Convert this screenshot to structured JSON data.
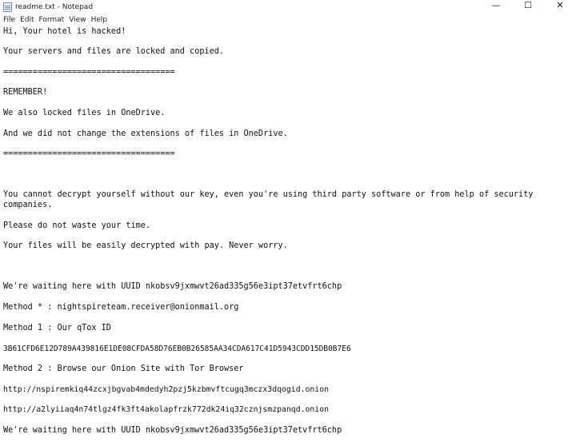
{
  "window": {
    "title": "readme.txt - Notepad",
    "icon": "notepad-icon",
    "controls": {
      "minimize": "—",
      "maximize": "☐",
      "close": "✕"
    }
  },
  "menu": [
    "File",
    "Edit",
    "Format",
    "View",
    "Help"
  ],
  "document": {
    "greeting": "Hi, Your hotel is hacked!",
    "locked": "Your servers and files are locked and copied.",
    "divider1": "===================================",
    "remember": "REMEMBER!",
    "onedrive1": "We also locked files in OneDrive.",
    "onedrive2": "And we did not change the extensions of files in OneDrive.",
    "divider2": "===================================",
    "decrypt_line1": "You cannot decrypt yourself without our key, even you're using third party software or from help of security",
    "decrypt_line2": "companies.",
    "waste": "Please do not waste your time.",
    "pay": "Your files will be easily decrypted with pay. Never worry.",
    "waiting1": "We're waiting here with UUID nkobsv9jxmwvt26ad335g56e3ipt37etvfrt6chp",
    "method_star": "Method * : nightspireteam.receiver@onionmail.org",
    "method1": "Method 1 : Our qTox ID",
    "qtox_id": "3B61CFD6E12D789A439816E1DE08CFDA58D76EB0B26585AA34CDA617C41D5943CDD15DB0B7E6",
    "method2": "Method 2 : Browse our Onion Site with Tor Browser",
    "onion1": "http://nspiremkiq44zcxjbgvab4mdedyh2pzj5kzbmvftcugq3mczx3dqogid.onion",
    "onion2": "http://a2lyiiaq4n74tlgz4fk3ft4akolapfrzk772dk24iq32cznjsmzpanqd.onion",
    "waiting2": "We're waiting here with UUID nkobsv9jxmwvt26ad335g56e3ipt37etvfrt6chp"
  }
}
